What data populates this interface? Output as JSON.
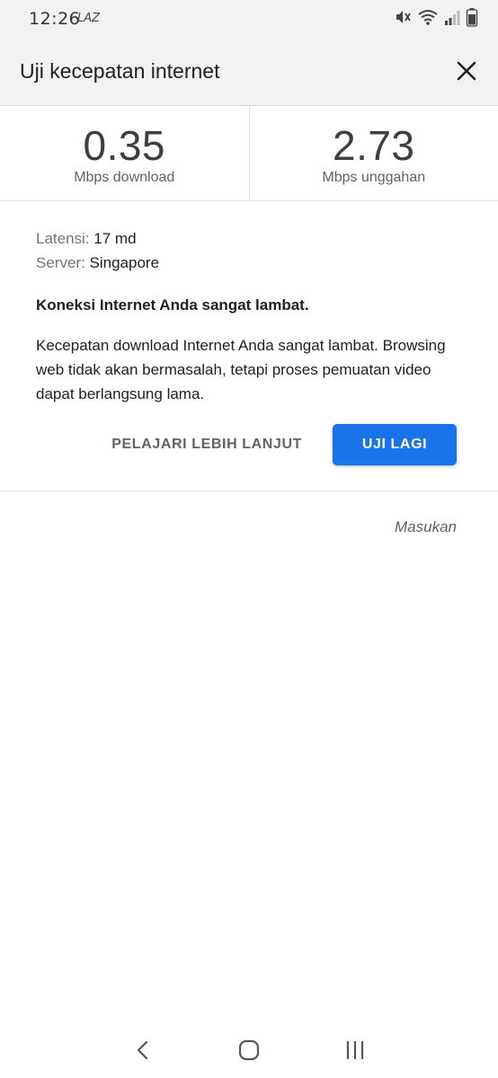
{
  "status_bar": {
    "time": "12:26",
    "app_indicator": "LAZ",
    "icons": [
      "mute-icon",
      "wifi-icon",
      "signal-icon",
      "battery-icon"
    ]
  },
  "header": {
    "title": "Uji kecepatan internet",
    "close_icon": "close-icon"
  },
  "speed": {
    "download_value": "0.35",
    "download_unit": "Mbps download",
    "upload_value": "2.73",
    "upload_unit": "Mbps unggahan"
  },
  "info": {
    "latency_label": "Latensi:",
    "latency_value": "17 md",
    "server_label": "Server:",
    "server_value": "Singapore",
    "verdict": "Koneksi Internet Anda sangat lambat.",
    "description": "Kecepatan download Internet Anda sangat lambat. Browsing web tidak akan bermasalah, tetapi proses pemuatan video dapat berlangsung lama."
  },
  "actions": {
    "learn_more": "PELAJARI LEBIH LANJUT",
    "retest": "UJI LAGI"
  },
  "feedback": "Masukan",
  "colors": {
    "accent": "#1a73e8",
    "header_bg": "#f2f2f2"
  },
  "nav_bar": {
    "icons": [
      "back-icon",
      "home-icon",
      "recents-icon"
    ]
  }
}
